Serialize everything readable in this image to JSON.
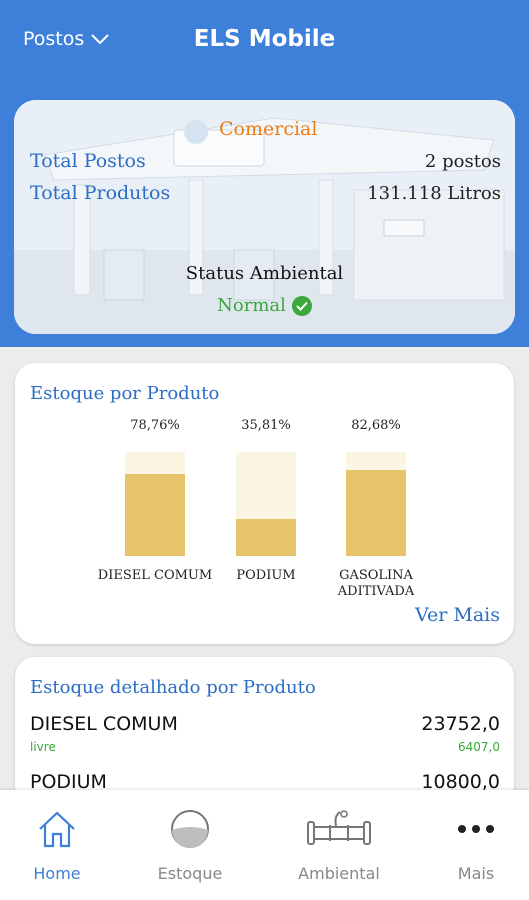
{
  "header": {
    "postos_label": "Postos",
    "title": "ELS Mobile"
  },
  "hero": {
    "company": "Comercial",
    "total_postos_label": "Total Postos",
    "total_postos_value": "2 postos",
    "total_produtos_label": "Total Produtos",
    "total_produtos_value": "131.118 Litros",
    "status_label": "Status Ambiental",
    "status_value": "Normal"
  },
  "estoque_produto": {
    "title": "Estoque por Produto",
    "bars": [
      {
        "percent_label": "78,76%",
        "fill": 0.7876,
        "label_line1": "DIESEL COMUM",
        "label_line2": ""
      },
      {
        "percent_label": "35,81%",
        "fill": 0.3581,
        "label_line1": "PODIUM",
        "label_line2": ""
      },
      {
        "percent_label": "82,68%",
        "fill": 0.8268,
        "label_line1": "GASOLINA",
        "label_line2": "ADITIVADA"
      }
    ],
    "ver_mais": "Ver Mais"
  },
  "estoque_detalhado": {
    "title": "Estoque detalhado por Produto",
    "rows": [
      {
        "name": "DIESEL COMUM",
        "value": "23752,0",
        "sub_label": "livre",
        "sub_value": "6407,0"
      },
      {
        "name": "PODIUM",
        "value": "10800,0"
      }
    ]
  },
  "nav": {
    "items": [
      {
        "label": "Home",
        "icon": "home-icon"
      },
      {
        "label": "Estoque",
        "icon": "tank-icon"
      },
      {
        "label": "Ambiental",
        "icon": "pipe-icon"
      },
      {
        "label": "Mais",
        "icon": "more-dots-icon"
      }
    ]
  },
  "colors": {
    "primary": "#3d7fd9",
    "accent_orange": "#ee7a12",
    "ok_green": "#3aa83a",
    "bar_fill": "#e5c46b",
    "bar_track": "#fbf6e3"
  }
}
